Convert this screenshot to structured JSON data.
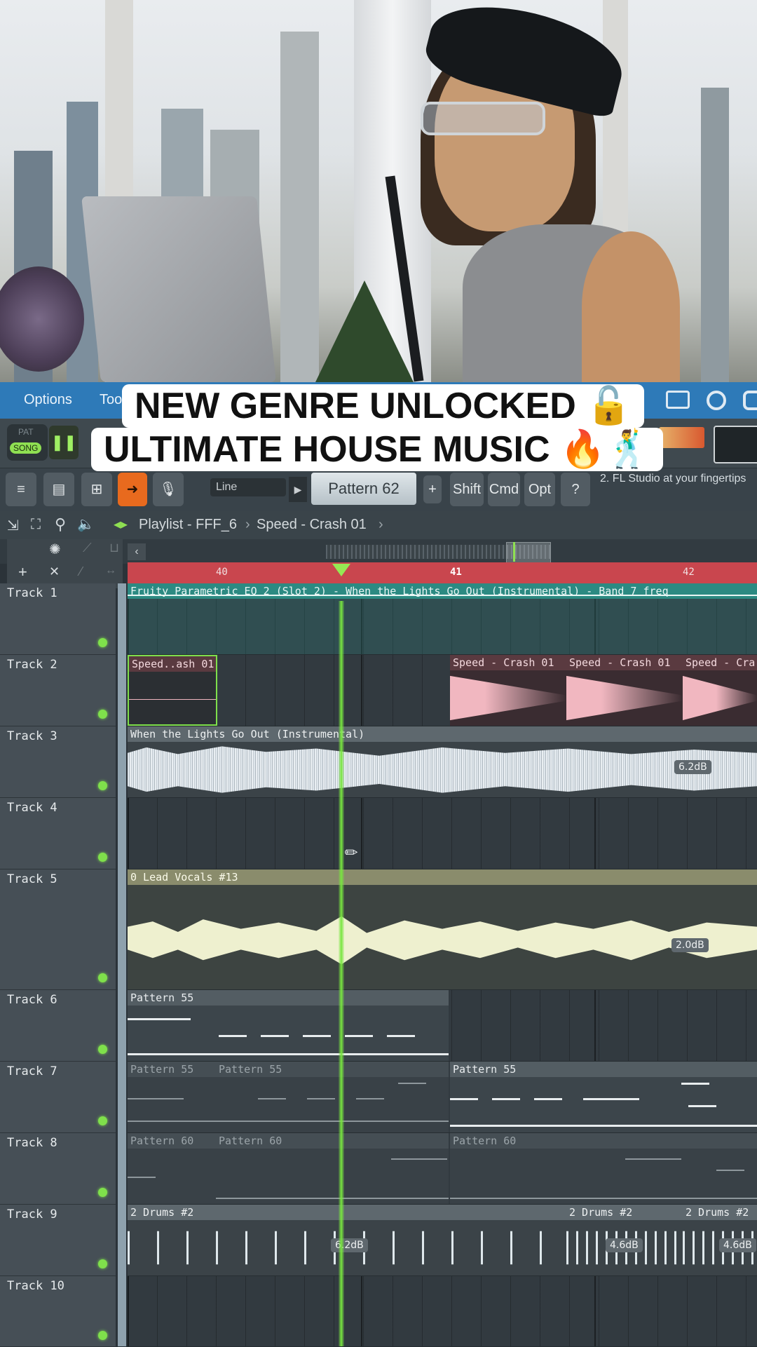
{
  "caption": {
    "line1": "NEW GENRE UNLOCKED 🔓",
    "line2": "ULTIMATE HOUSE MUSIC 🔥🕺"
  },
  "menubar": {
    "items": [
      "Options",
      "Too"
    ]
  },
  "toolbar": {
    "pat_label": "PAT",
    "song_label": "SONG",
    "snap_label": "Line",
    "pattern_selector": "Pattern 62",
    "pattern_add": "+",
    "shift_label": "Shift",
    "cmd_label": "Cmd",
    "opt_label": "Opt",
    "hint_text": "2. FL Studio at your fingertips"
  },
  "playlist": {
    "breadcrumb_title": "Playlist - FFF_6",
    "breadcrumb_sep1": "›",
    "breadcrumb_clip": "Speed - Crash 01",
    "breadcrumb_sep2": "›"
  },
  "ruler": {
    "bars": [
      "40",
      "41",
      "42"
    ]
  },
  "tracks": [
    {
      "name": "Track 1"
    },
    {
      "name": "Track 2"
    },
    {
      "name": "Track 3"
    },
    {
      "name": "Track 4"
    },
    {
      "name": "Track 5"
    },
    {
      "name": "Track 6"
    },
    {
      "name": "Track 7"
    },
    {
      "name": "Track 8"
    },
    {
      "name": "Track 9"
    },
    {
      "name": "Track 10"
    }
  ],
  "clips": {
    "t1_auto": "Fruity Parametric EQ 2 (Slot 2) - When the Lights Go Out (Instrumental) - Band 7 freq",
    "t2_a": "Speed..ash 01",
    "t2_b": "Speed - Crash 01",
    "t2_c": "Speed - Crash 01",
    "t2_d": "Speed - Cra",
    "t3_a": "When the Lights Go Out (Instrumental)",
    "t3_db": "6.2dB",
    "t5_a": "0 Lead Vocals #13",
    "t5_db": "2.0dB",
    "t6_a": "Pattern 55",
    "t7_a": "Pattern 55",
    "t7_b": "Pattern 55",
    "t7_c": "Pattern 55",
    "t8_a": "Pattern 60",
    "t8_b": "Pattern 60",
    "t8_c": "Pattern 60",
    "t9_a": "2 Drums #2",
    "t9_b": "2 Drums #2",
    "t9_c": "2 Drums #2",
    "t9_db1": "6.2dB",
    "t9_db2": "4.6dB",
    "t9_db3": "4.6dB"
  },
  "colors": {
    "accent_blue": "#2e7ab8",
    "ruler_red": "#c9464e",
    "playhead_green": "#78e640",
    "crash_pink": "#f1b7c0",
    "vocal_cream": "#eef0cf",
    "automation_teal": "#2c8a82"
  }
}
